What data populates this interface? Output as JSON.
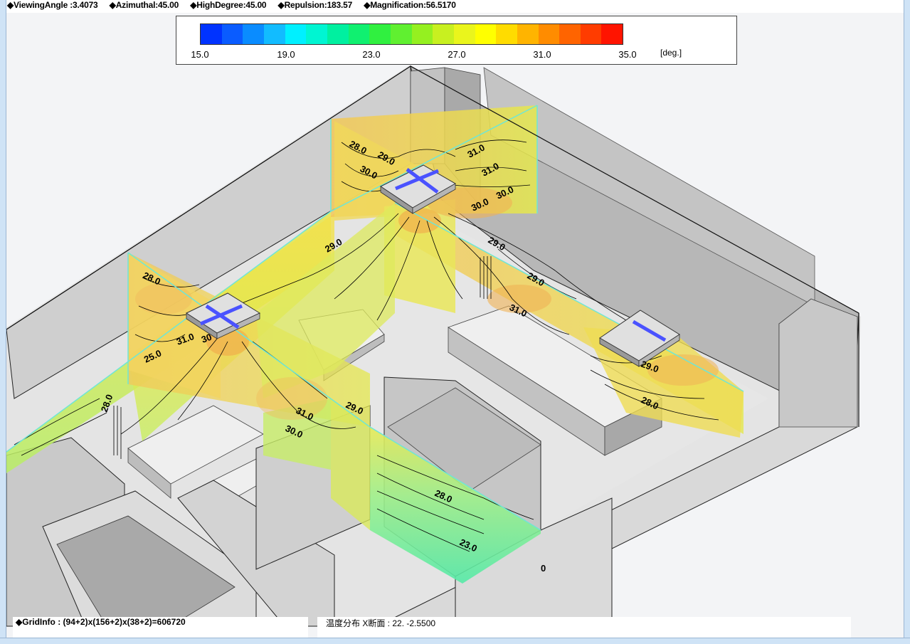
{
  "params": {
    "viewing_angle": "◆ViewingAngle :3.4073",
    "azimuthal": "◆Azimuthal:45.00",
    "high_degree": "◆HighDegree:45.00",
    "repulsion": "◆Repulsion:183.57",
    "magnification": "◆Magnification:56.5170"
  },
  "legend": {
    "ticks": [
      "15.0",
      "19.0",
      "23.0",
      "27.0",
      "31.0",
      "35.0"
    ],
    "unit": "[deg.]",
    "colors": [
      "#0033ff",
      "#0a5cff",
      "#0a8cff",
      "#12bcff",
      "#00f0ff",
      "#00f5d2",
      "#00f0a0",
      "#10f070",
      "#30f040",
      "#60f030",
      "#95f020",
      "#c8f020",
      "#eaf51c",
      "#ffff00",
      "#ffdc00",
      "#ffb400",
      "#ff8c00",
      "#ff6400",
      "#ff3c00",
      "#ff1400"
    ]
  },
  "contours": {
    "labels": [
      "28.0",
      "29.0",
      "30.0",
      "31.0",
      "31.0",
      "30.0",
      "30.0",
      "29.0",
      "29.0",
      "29.0",
      "31.0",
      "28.0",
      "31.0",
      "30",
      "25.0",
      "28.0",
      "31.0",
      "30.0",
      "29.0",
      "28.0",
      "29.0",
      "28.0",
      "23.0",
      "0"
    ]
  },
  "status": {
    "grid_info": "◆GridInfo : (94+2)x(156+2)x(38+2)=606720",
    "section": "温度分布 X断面 : 22.  -2.5500"
  }
}
